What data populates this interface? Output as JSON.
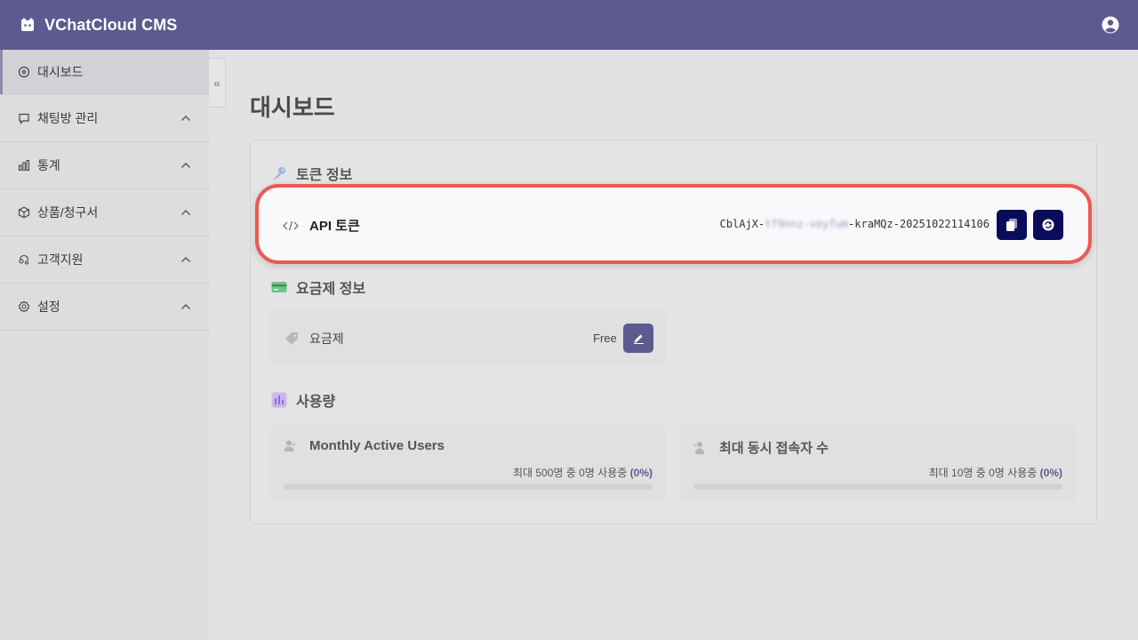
{
  "app": {
    "title": "VChatCloud CMS"
  },
  "sidebar": {
    "items": [
      {
        "label": "대시보드",
        "icon": "dashboard-icon"
      },
      {
        "label": "채팅방 관리",
        "icon": "chat-icon"
      },
      {
        "label": "통계",
        "icon": "bar-chart-icon"
      },
      {
        "label": "상품/청구서",
        "icon": "box-icon"
      },
      {
        "label": "고객지원",
        "icon": "support-icon"
      },
      {
        "label": "설정",
        "icon": "gear-icon"
      }
    ],
    "collapse_label": "«"
  },
  "page": {
    "title": "대시보드"
  },
  "token_section": {
    "title": "토큰 정보",
    "api_label": "API 토큰",
    "token_prefix": "CblAjX-",
    "token_blurred": "tf9nnz-veyfum",
    "token_suffix": "-kraMQz-20251022114106"
  },
  "plan_section": {
    "title": "요금제 정보",
    "plan_label": "요금제",
    "plan_value": "Free"
  },
  "usage_section": {
    "title": "사용량",
    "mau": {
      "title": "Monthly Active Users",
      "caption": "최대 500명 중 0명 사용중",
      "percent_label": "(0%)",
      "percent": 0
    },
    "concurrent": {
      "title": "최대 동시 접속자 수",
      "caption": "최대 10명 중 0명 사용중",
      "percent_label": "(0%)",
      "percent": 0
    }
  },
  "colors": {
    "header": "#5c5a8e",
    "button_dark": "#0b0b5c",
    "highlight": "#ec5a52"
  }
}
